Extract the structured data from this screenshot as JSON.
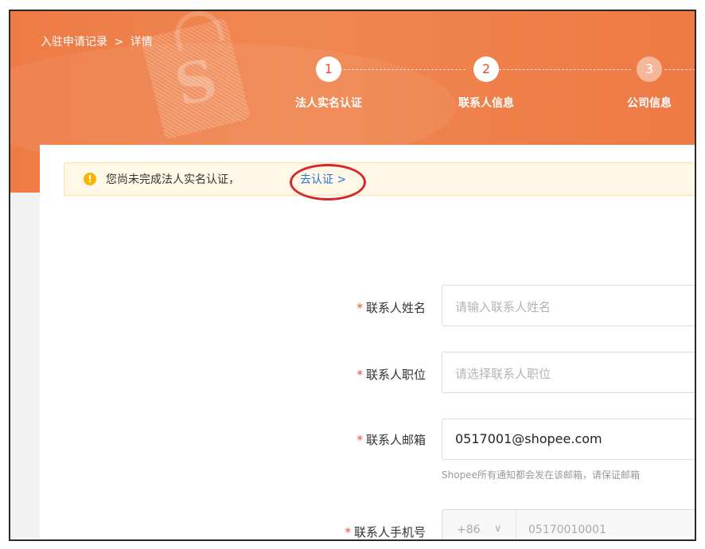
{
  "breadcrumb": {
    "parent": "入驻申请记录",
    "separator": ">",
    "current": "详情"
  },
  "steps": [
    {
      "number": "1",
      "label": "法人实名认证"
    },
    {
      "number": "2",
      "label": "联系人信息"
    },
    {
      "number": "3",
      "label": "公司信息"
    }
  ],
  "notice": {
    "text": "您尚未完成法人实名认证，",
    "link": "去认证 >"
  },
  "form": {
    "name": {
      "label": "联系人姓名",
      "placeholder": "请输入联系人姓名"
    },
    "position": {
      "label": "联系人职位",
      "placeholder": "请选择联系人职位"
    },
    "email": {
      "label": "联系人邮箱",
      "value": "0517001@shopee.com",
      "hint": "Shopee所有通知都会发在该邮箱，请保证邮箱"
    },
    "phone": {
      "label": "联系人手机号",
      "country_code": "+86",
      "value": "05170010001"
    }
  },
  "colors": {
    "banner": "#ee7b46",
    "accent": "#ee4d2d",
    "link": "#2673dd",
    "notice_bg": "#fff8e6",
    "annotation": "#d9262a"
  },
  "icons": {
    "notice": "exclamation-circle-icon",
    "dropdown": "chevron-down-icon"
  }
}
